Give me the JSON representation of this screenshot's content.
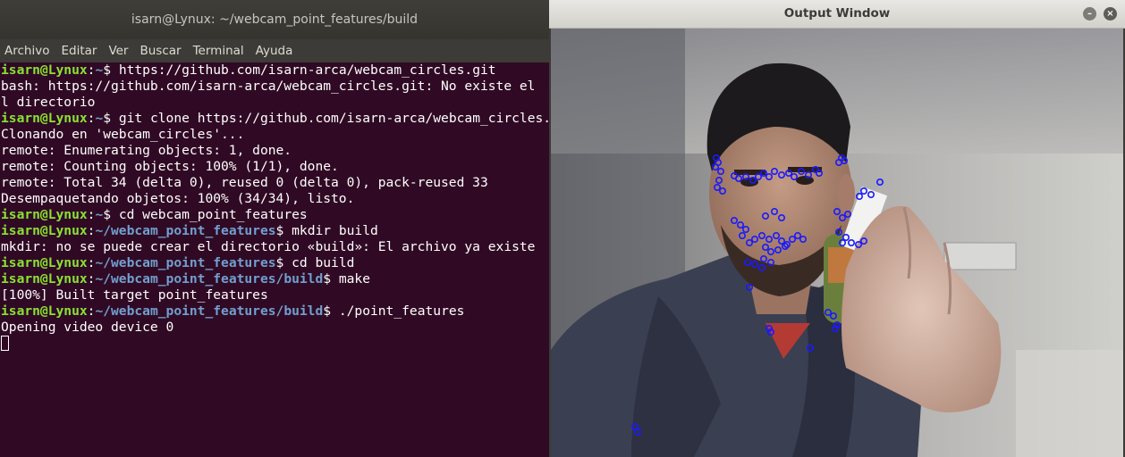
{
  "terminal": {
    "title": "isarn@Lynux: ~/webcam_point_features/build",
    "menu": [
      "Archivo",
      "Editar",
      "Ver",
      "Buscar",
      "Terminal",
      "Ayuda"
    ],
    "lines": [
      {
        "user": "isarn@Lynux",
        "sep": ":",
        "path": "~",
        "prompt": "$ ",
        "cmd": "https://github.com/isarn-arca/webcam_circles.git"
      },
      {
        "text": "bash: https://github.com/isarn-arca/webcam_circles.git: No existe el"
      },
      {
        "text": "l directorio"
      },
      {
        "user": "isarn@Lynux",
        "sep": ":",
        "path": "~",
        "prompt": "$ ",
        "cmd": "git clone https://github.com/isarn-arca/webcam_circles."
      },
      {
        "text": "Clonando en 'webcam_circles'..."
      },
      {
        "text": "remote: Enumerating objects: 1, done."
      },
      {
        "text": "remote: Counting objects: 100% (1/1), done."
      },
      {
        "text": "remote: Total 34 (delta 0), reused 0 (delta 0), pack-reused 33"
      },
      {
        "text": "Desempaquetando objetos: 100% (34/34), listo."
      },
      {
        "user": "isarn@Lynux",
        "sep": ":",
        "path": "~",
        "prompt": "$ ",
        "cmd": "cd webcam_point_features"
      },
      {
        "user": "isarn@Lynux",
        "sep": ":",
        "path": "~/webcam_point_features",
        "prompt": "$ ",
        "cmd": "mkdir build"
      },
      {
        "text": "mkdir: no se puede crear el directorio «build»: El archivo ya existe"
      },
      {
        "user": "isarn@Lynux",
        "sep": ":",
        "path": "~/webcam_point_features",
        "prompt": "$ ",
        "cmd": "cd build"
      },
      {
        "user": "isarn@Lynux",
        "sep": ":",
        "path": "~/webcam_point_features/build",
        "prompt": "$ ",
        "cmd": "make"
      },
      {
        "text": "[100%] Built target point_features"
      },
      {
        "user": "isarn@Lynux",
        "sep": ":",
        "path": "~/webcam_point_features/build",
        "prompt": "$ ",
        "cmd": "./point_features"
      },
      {
        "text": "Opening video device 0"
      }
    ]
  },
  "output_window": {
    "title": "Output Window",
    "minimize_glyph": "–",
    "close_glyph": "×",
    "feature_point_color": "#1a1aff"
  },
  "colors": {
    "terminal_bg": "#300a24",
    "prompt_user": "#8ae234",
    "prompt_path": "#729fcf"
  }
}
